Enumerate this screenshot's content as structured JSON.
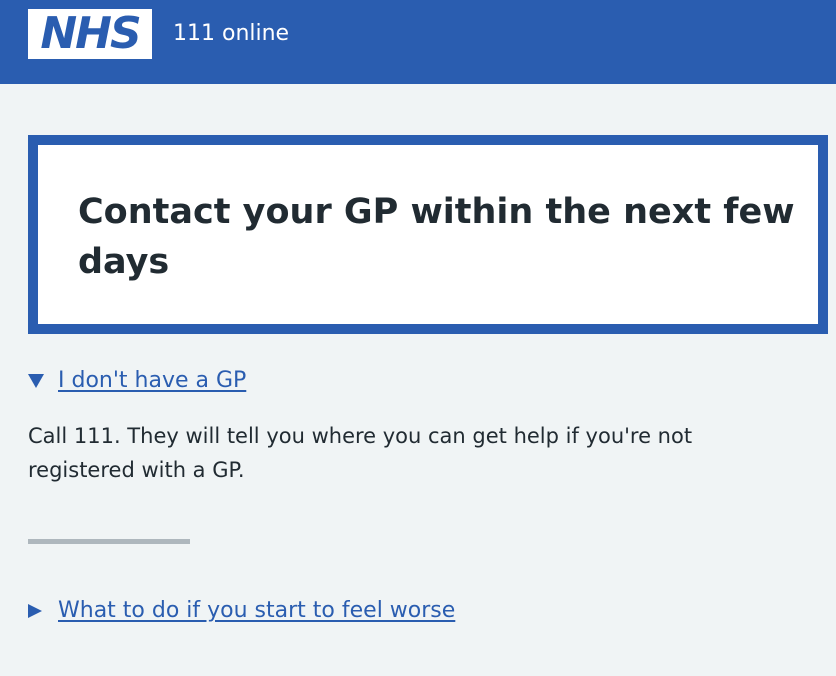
{
  "header": {
    "logo_text": "NHS",
    "service_name": "111 online"
  },
  "care_card": {
    "title": "Contact your GP within the next few days"
  },
  "details_no_gp": {
    "summary": "I don't have a GP",
    "expanded": true,
    "text": "Call 111. They will tell you where you can get help if you're not registered with a GP."
  },
  "details_worse": {
    "summary": "What to do if you start to feel worse",
    "expanded": false
  },
  "colors": {
    "brand_blue": "#2a5db0",
    "background": "#f0f4f5",
    "divider": "#aeb7bd"
  },
  "icons": {
    "expanded": "triangle-down-icon",
    "collapsed": "triangle-right-icon"
  }
}
